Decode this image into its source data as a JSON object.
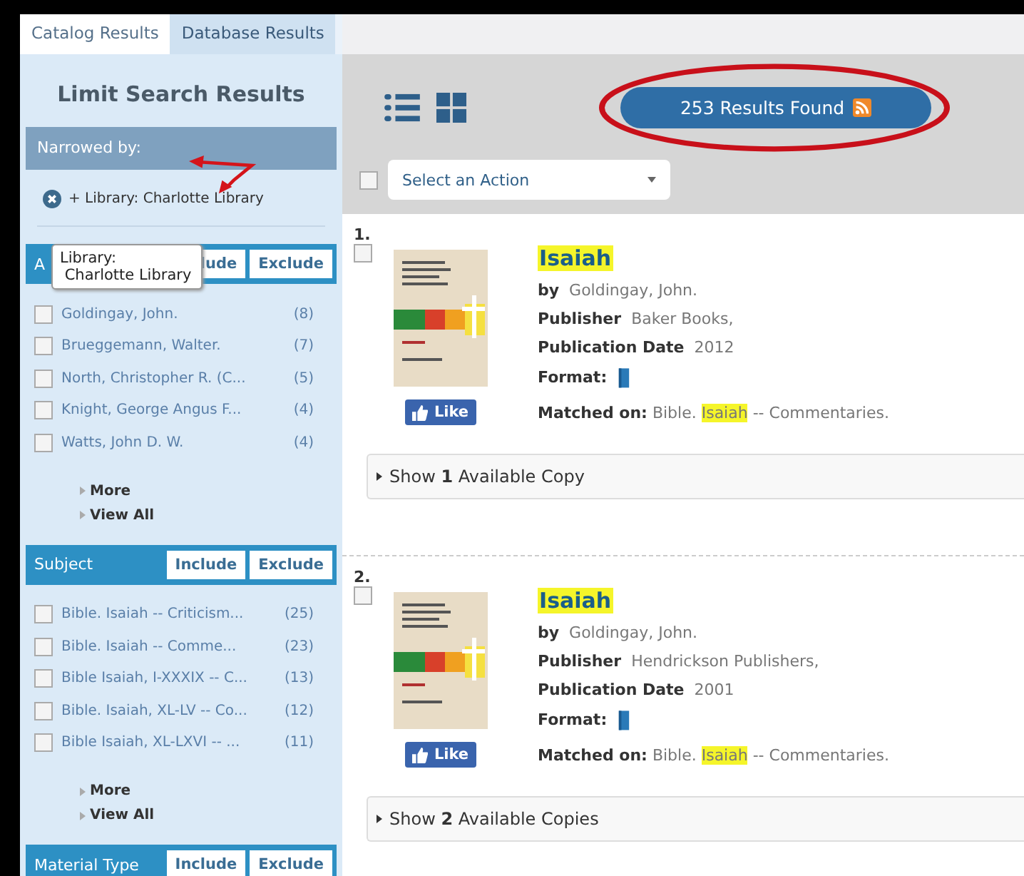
{
  "tabs": [
    {
      "label": "Catalog Results",
      "selected": true
    },
    {
      "label": "Database Results",
      "selected": false
    }
  ],
  "sidebar": {
    "title": "Limit Search Results",
    "narrowed_by": "Narrowed by:",
    "filters": [
      {
        "label": "+ Library: Charlotte Library"
      }
    ],
    "tooltip": {
      "line_1": "Library:",
      "line_2": "Charlotte Library"
    },
    "facets": [
      {
        "title": "A",
        "include": "lude",
        "exclude": "Exclude",
        "items": [
          {
            "label": "Goldingay, John.",
            "count": "(8)",
            "checked": false
          },
          {
            "label": "Brueggemann, Walter.",
            "count": "(7)",
            "checked": false
          },
          {
            "label": "North, Christopher R. (C...",
            "count": "(5)",
            "checked": false
          },
          {
            "label": "Knight, George Angus F...",
            "count": "(4)",
            "checked": false
          },
          {
            "label": "Watts, John D. W.",
            "count": "(4)",
            "checked": false
          }
        ],
        "links": [
          "More",
          "View All"
        ]
      },
      {
        "title": "Subject",
        "include": "Include",
        "exclude": "Exclude",
        "items": [
          {
            "label": "Bible. Isaiah -- Criticism...",
            "count": "(25)",
            "checked": false
          },
          {
            "label": "Bible. Isaiah -- Comme...",
            "count": "(23)",
            "checked": false
          },
          {
            "label": "Bible Isaiah, I-XXXIX -- C...",
            "count": "(13)",
            "checked": false
          },
          {
            "label": "Bible. Isaiah, XL-LV -- Co...",
            "count": "(12)",
            "checked": false
          },
          {
            "label": "Bible Isaiah, XL-LXVI -- ...",
            "count": "(11)",
            "checked": false
          }
        ],
        "links": [
          "More",
          "View All"
        ]
      },
      {
        "title": "Material Type",
        "include": "Include",
        "exclude": "Exclude"
      }
    ]
  },
  "toolbar": {
    "results_count": "253 Results Found",
    "select_all_checked": false,
    "action_select": {
      "value": "Select an Action"
    }
  },
  "results": [
    {
      "number": "1.",
      "checked": false,
      "title": "Isaiah",
      "by_label": "by",
      "author": "Goldingay, John.",
      "publisher_label": "Publisher",
      "publisher": "Baker Books,",
      "date_label": "Publication Date",
      "date": "2012",
      "format_label": "Format:",
      "matched_label": "Matched on:",
      "matched_before": "Bible.",
      "matched_highlight": "Isaiah",
      "matched_after": "-- Commentaries.",
      "like": "Like",
      "copies": "Show **1** Available Copy"
    },
    {
      "number": "2.",
      "checked": false,
      "title": "Isaiah",
      "by_label": "by",
      "author": "Goldingay, John.",
      "publisher_label": "Publisher",
      "publisher": "Hendrickson Publishers,",
      "date_label": "Publication Date",
      "date": "2001",
      "format_label": "Format:",
      "matched_label": "Matched on:",
      "matched_before": "Bible.",
      "matched_highlight": "Isaiah",
      "matched_after": "-- Commentaries.",
      "like": "Like",
      "copies": "Show **2** Available Copies"
    }
  ]
}
